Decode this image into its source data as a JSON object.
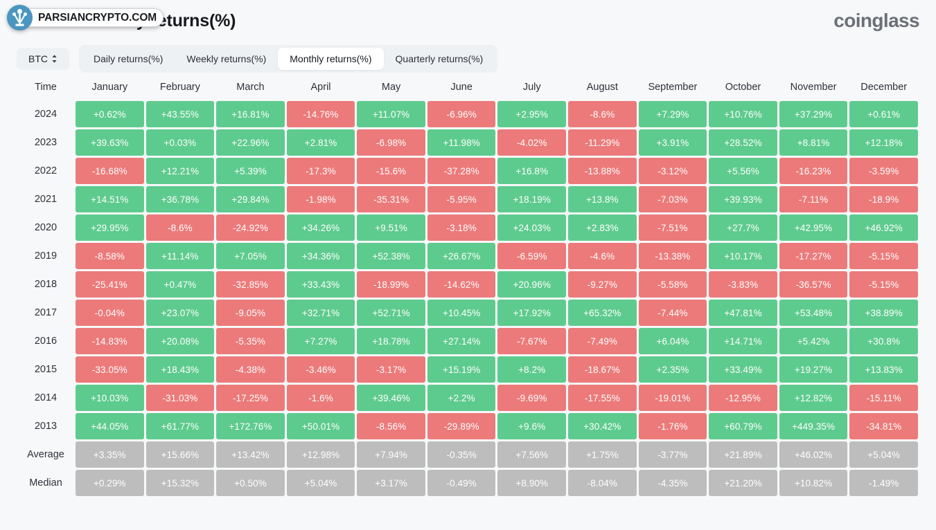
{
  "header": {
    "title": "Bitcoin Monthly returns(%)",
    "brand": "coinglass",
    "watermark": {
      "text": "PARSIANCRYPTO.COM",
      "icon": "parsiancrypto-logo-icon"
    }
  },
  "controls": {
    "coin_selector": {
      "value": "BTC",
      "icon": "up-down-chevron-icon"
    },
    "tabs": [
      {
        "label": "Daily returns(%)",
        "active": false,
        "name": "tab-daily-returns"
      },
      {
        "label": "Weekly returns(%)",
        "active": false,
        "name": "tab-weekly-returns"
      },
      {
        "label": "Monthly returns(%)",
        "active": true,
        "name": "tab-monthly-returns"
      },
      {
        "label": "Quarterly returns(%)",
        "active": false,
        "name": "tab-quarterly-returns"
      }
    ]
  },
  "colors": {
    "positive": "#5ecb8e",
    "negative": "#ec7a7a",
    "stat": "#bdbdbd",
    "page_background": "#f7f8f9",
    "tab_track": "#eef1f4",
    "tab_active": "#ffffff"
  },
  "chart_data": {
    "type": "heatmap",
    "title": "Bitcoin Monthly returns(%)",
    "xlabel": "",
    "ylabel": "Time",
    "legend": "green = positive return, red = negative return, grey = summary statistic",
    "columns": [
      "Time",
      "January",
      "February",
      "March",
      "April",
      "May",
      "June",
      "July",
      "August",
      "September",
      "October",
      "November",
      "December"
    ],
    "categories": [
      "January",
      "February",
      "March",
      "April",
      "May",
      "June",
      "July",
      "August",
      "September",
      "October",
      "November",
      "December"
    ],
    "rows": [
      {
        "label": "2024",
        "kind": "year",
        "values": [
          "+0.62%",
          "+43.55%",
          "+16.81%",
          "-14.76%",
          "+11.07%",
          "-6.96%",
          "+2.95%",
          "-8.6%",
          "+7.29%",
          "+10.76%",
          "+37.29%",
          "+0.61%"
        ],
        "numeric": [
          0.62,
          43.55,
          16.81,
          -14.76,
          11.07,
          -6.96,
          2.95,
          -8.6,
          7.29,
          10.76,
          37.29,
          0.61
        ]
      },
      {
        "label": "2023",
        "kind": "year",
        "values": [
          "+39.63%",
          "+0.03%",
          "+22.96%",
          "+2.81%",
          "-6.98%",
          "+11.98%",
          "-4.02%",
          "-11.29%",
          "+3.91%",
          "+28.52%",
          "+8.81%",
          "+12.18%"
        ],
        "numeric": [
          39.63,
          0.03,
          22.96,
          2.81,
          -6.98,
          11.98,
          -4.02,
          -11.29,
          3.91,
          28.52,
          8.81,
          12.18
        ]
      },
      {
        "label": "2022",
        "kind": "year",
        "values": [
          "-16.68%",
          "+12.21%",
          "+5.39%",
          "-17.3%",
          "-15.6%",
          "-37.28%",
          "+16.8%",
          "-13.88%",
          "-3.12%",
          "+5.56%",
          "-16.23%",
          "-3.59%"
        ],
        "numeric": [
          -16.68,
          12.21,
          5.39,
          -17.3,
          -15.6,
          -37.28,
          16.8,
          -13.88,
          -3.12,
          5.56,
          -16.23,
          -3.59
        ]
      },
      {
        "label": "2021",
        "kind": "year",
        "values": [
          "+14.51%",
          "+36.78%",
          "+29.84%",
          "-1.98%",
          "-35.31%",
          "-5.95%",
          "+18.19%",
          "+13.8%",
          "-7.03%",
          "+39.93%",
          "-7.11%",
          "-18.9%"
        ],
        "numeric": [
          14.51,
          36.78,
          29.84,
          -1.98,
          -35.31,
          -5.95,
          18.19,
          13.8,
          -7.03,
          39.93,
          -7.11,
          -18.9
        ]
      },
      {
        "label": "2020",
        "kind": "year",
        "values": [
          "+29.95%",
          "-8.6%",
          "-24.92%",
          "+34.26%",
          "+9.51%",
          "-3.18%",
          "+24.03%",
          "+2.83%",
          "-7.51%",
          "+27.7%",
          "+42.95%",
          "+46.92%"
        ],
        "numeric": [
          29.95,
          -8.6,
          -24.92,
          34.26,
          9.51,
          -3.18,
          24.03,
          2.83,
          -7.51,
          27.7,
          42.95,
          46.92
        ]
      },
      {
        "label": "2019",
        "kind": "year",
        "values": [
          "-8.58%",
          "+11.14%",
          "+7.05%",
          "+34.36%",
          "+52.38%",
          "+26.67%",
          "-6.59%",
          "-4.6%",
          "-13.38%",
          "+10.17%",
          "-17.27%",
          "-5.15%"
        ],
        "numeric": [
          -8.58,
          11.14,
          7.05,
          34.36,
          52.38,
          26.67,
          -6.59,
          -4.6,
          -13.38,
          10.17,
          -17.27,
          -5.15
        ]
      },
      {
        "label": "2018",
        "kind": "year",
        "values": [
          "-25.41%",
          "+0.47%",
          "-32.85%",
          "+33.43%",
          "-18.99%",
          "-14.62%",
          "+20.96%",
          "-9.27%",
          "-5.58%",
          "-3.83%",
          "-36.57%",
          "-5.15%"
        ],
        "numeric": [
          -25.41,
          0.47,
          -32.85,
          33.43,
          -18.99,
          -14.62,
          20.96,
          -9.27,
          -5.58,
          -3.83,
          -36.57,
          -5.15
        ]
      },
      {
        "label": "2017",
        "kind": "year",
        "values": [
          "-0.04%",
          "+23.07%",
          "-9.05%",
          "+32.71%",
          "+52.71%",
          "+10.45%",
          "+17.92%",
          "+65.32%",
          "-7.44%",
          "+47.81%",
          "+53.48%",
          "+38.89%"
        ],
        "numeric": [
          -0.04,
          23.07,
          -9.05,
          32.71,
          52.71,
          10.45,
          17.92,
          65.32,
          -7.44,
          47.81,
          53.48,
          38.89
        ]
      },
      {
        "label": "2016",
        "kind": "year",
        "values": [
          "-14.83%",
          "+20.08%",
          "-5.35%",
          "+7.27%",
          "+18.78%",
          "+27.14%",
          "-7.67%",
          "-7.49%",
          "+6.04%",
          "+14.71%",
          "+5.42%",
          "+30.8%"
        ],
        "numeric": [
          -14.83,
          20.08,
          -5.35,
          7.27,
          18.78,
          27.14,
          -7.67,
          -7.49,
          6.04,
          14.71,
          5.42,
          30.8
        ]
      },
      {
        "label": "2015",
        "kind": "year",
        "values": [
          "-33.05%",
          "+18.43%",
          "-4.38%",
          "-3.46%",
          "-3.17%",
          "+15.19%",
          "+8.2%",
          "-18.67%",
          "+2.35%",
          "+33.49%",
          "+19.27%",
          "+13.83%"
        ],
        "numeric": [
          -33.05,
          18.43,
          -4.38,
          -3.46,
          -3.17,
          15.19,
          8.2,
          -18.67,
          2.35,
          33.49,
          19.27,
          13.83
        ]
      },
      {
        "label": "2014",
        "kind": "year",
        "values": [
          "+10.03%",
          "-31.03%",
          "-17.25%",
          "-1.6%",
          "+39.46%",
          "+2.2%",
          "-9.69%",
          "-17.55%",
          "-19.01%",
          "-12.95%",
          "+12.82%",
          "-15.11%"
        ],
        "numeric": [
          10.03,
          -31.03,
          -17.25,
          -1.6,
          39.46,
          2.2,
          -9.69,
          -17.55,
          -19.01,
          -12.95,
          12.82,
          -15.11
        ]
      },
      {
        "label": "2013",
        "kind": "year",
        "values": [
          "+44.05%",
          "+61.77%",
          "+172.76%",
          "+50.01%",
          "-8.56%",
          "-29.89%",
          "+9.6%",
          "+30.42%",
          "-1.76%",
          "+60.79%",
          "+449.35%",
          "-34.81%"
        ],
        "numeric": [
          44.05,
          61.77,
          172.76,
          50.01,
          -8.56,
          -29.89,
          9.6,
          30.42,
          -1.76,
          60.79,
          449.35,
          -34.81
        ]
      },
      {
        "label": "Average",
        "kind": "stat",
        "values": [
          "+3.35%",
          "+15.66%",
          "+13.42%",
          "+12.98%",
          "+7.94%",
          "-0.35%",
          "+7.56%",
          "+1.75%",
          "-3.77%",
          "+21.89%",
          "+46.02%",
          "+5.04%"
        ],
        "numeric": [
          3.35,
          15.66,
          13.42,
          12.98,
          7.94,
          -0.35,
          7.56,
          1.75,
          -3.77,
          21.89,
          46.02,
          5.04
        ]
      },
      {
        "label": "Median",
        "kind": "stat",
        "values": [
          "+0.29%",
          "+15.32%",
          "+0.50%",
          "+5.04%",
          "+3.17%",
          "-0.49%",
          "+8.90%",
          "-8.04%",
          "-4.35%",
          "+21.20%",
          "+10.82%",
          "-1.49%"
        ],
        "numeric": [
          0.29,
          15.32,
          0.5,
          5.04,
          3.17,
          -0.49,
          8.9,
          -8.04,
          -4.35,
          21.2,
          10.82,
          -1.49
        ]
      }
    ]
  }
}
